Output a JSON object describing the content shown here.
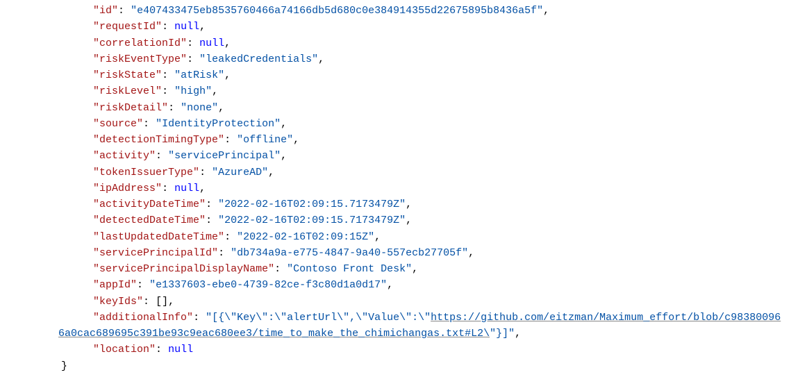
{
  "json": {
    "entries": [
      {
        "key": "id",
        "valueType": "string",
        "value": "e407433475eb8535760466a74166db5d680c0e384914355d22675895b8436a5f",
        "trailingComma": true
      },
      {
        "key": "requestId",
        "valueType": "null",
        "value": "null",
        "trailingComma": true
      },
      {
        "key": "correlationId",
        "valueType": "null",
        "value": "null",
        "trailingComma": true
      },
      {
        "key": "riskEventType",
        "valueType": "string",
        "value": "leakedCredentials",
        "trailingComma": true
      },
      {
        "key": "riskState",
        "valueType": "string",
        "value": "atRisk",
        "trailingComma": true
      },
      {
        "key": "riskLevel",
        "valueType": "string",
        "value": "high",
        "trailingComma": true
      },
      {
        "key": "riskDetail",
        "valueType": "string",
        "value": "none",
        "trailingComma": true
      },
      {
        "key": "source",
        "valueType": "string",
        "value": "IdentityProtection",
        "trailingComma": true
      },
      {
        "key": "detectionTimingType",
        "valueType": "string",
        "value": "offline",
        "trailingComma": true
      },
      {
        "key": "activity",
        "valueType": "string",
        "value": "servicePrincipal",
        "trailingComma": true
      },
      {
        "key": "tokenIssuerType",
        "valueType": "string",
        "value": "AzureAD",
        "trailingComma": true
      },
      {
        "key": "ipAddress",
        "valueType": "null",
        "value": "null",
        "trailingComma": true
      },
      {
        "key": "activityDateTime",
        "valueType": "string",
        "value": "2022-02-16T02:09:15.7173479Z",
        "trailingComma": true
      },
      {
        "key": "detectedDateTime",
        "valueType": "string",
        "value": "2022-02-16T02:09:15.7173479Z",
        "trailingComma": true
      },
      {
        "key": "lastUpdatedDateTime",
        "valueType": "string",
        "value": "2022-02-16T02:09:15Z",
        "trailingComma": true
      },
      {
        "key": "servicePrincipalId",
        "valueType": "string",
        "value": "db734a9a-e775-4847-9a40-557ecb27705f",
        "trailingComma": true
      },
      {
        "key": "servicePrincipalDisplayName",
        "valueType": "string",
        "value": "Contoso Front Desk",
        "trailingComma": true
      },
      {
        "key": "appId",
        "valueType": "string",
        "value": "e1337603-ebe0-4739-82ce-f3c80d1a0d17",
        "trailingComma": true
      },
      {
        "key": "keyIds",
        "valueType": "array",
        "value": "[]",
        "trailingComma": true
      },
      {
        "key": "additionalInfo",
        "valueType": "urlstring",
        "prefix": "[{\\\"Key\\\":\\\"alertUrl\\\",\\\"Value\\\":\\\"",
        "url": "https://github.com/eitzman/Maximum_effort/blob/c983800966a0cac689695c391be93c9eac680ee3/time_to_make_the_chimichangas.txt#L2\\",
        "suffix": "\"}]",
        "trailingComma": true
      },
      {
        "key": "location",
        "valueType": "null",
        "value": "null",
        "trailingComma": false
      }
    ],
    "closeBrace": "}"
  }
}
